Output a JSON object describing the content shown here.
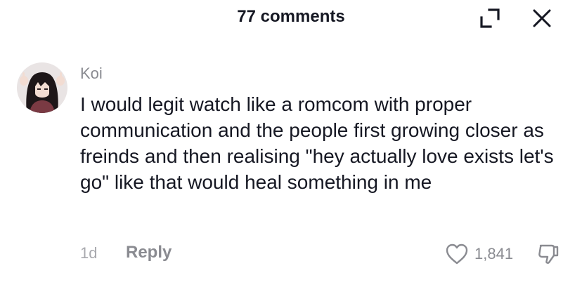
{
  "header": {
    "title": "77 comments",
    "expand_icon": "expand-icon",
    "close_icon": "close-icon"
  },
  "comment": {
    "username": "Koi",
    "text": "I would legit watch like a romcom with proper communication and the people first growing closer as freinds and then realising \"hey actually love exists let's go\" like that would heal something in me",
    "timestamp": "1d",
    "reply_label": "Reply",
    "like_count": "1,841",
    "like_icon": "heart-icon",
    "dislike_icon": "thumbs-down-icon"
  },
  "colors": {
    "primary_text": "#161823",
    "secondary_text": "#8a8b91",
    "tertiary_text": "#a8a9ae",
    "background": "#ffffff"
  }
}
